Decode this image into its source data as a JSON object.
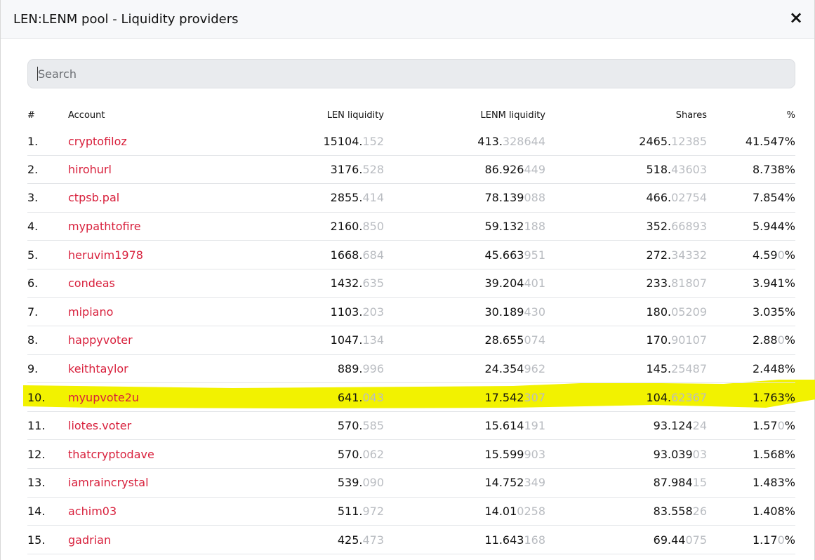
{
  "modal": {
    "title": "LEN:LENM pool - Liquidity providers",
    "close_icon": "×"
  },
  "search": {
    "placeholder": "Search",
    "value": ""
  },
  "columns": [
    "#",
    "Account",
    "LEN liquidity",
    "LENM liquidity",
    "Shares",
    "%"
  ],
  "highlight_color": "#f2f200",
  "accent_color": "#d8203c",
  "rows": [
    {
      "n": "1.",
      "account": "cryptofiloz",
      "len": [
        "15104.",
        "152"
      ],
      "lenm": [
        "413.",
        "328644"
      ],
      "shares": [
        "2465.",
        "12385"
      ],
      "pct": [
        "41.547%",
        ""
      ],
      "pct_tail": ""
    },
    {
      "n": "2.",
      "account": "hirohurl",
      "len": [
        "3176.",
        "528"
      ],
      "lenm": [
        "86.926",
        "449"
      ],
      "shares": [
        "518.",
        "43603"
      ],
      "pct": [
        "8.738%",
        ""
      ],
      "pct_tail": ""
    },
    {
      "n": "3.",
      "account": "ctpsb.pal",
      "len": [
        "2855.",
        "414"
      ],
      "lenm": [
        "78.139",
        "088"
      ],
      "shares": [
        "466.",
        "02754"
      ],
      "pct": [
        "7.854%",
        ""
      ],
      "pct_tail": ""
    },
    {
      "n": "4.",
      "account": "mypathtofire",
      "len": [
        "2160.",
        "850"
      ],
      "lenm": [
        "59.132",
        "188"
      ],
      "shares": [
        "352.",
        "66893"
      ],
      "pct": [
        "5.944%",
        ""
      ],
      "pct_tail": ""
    },
    {
      "n": "5.",
      "account": "heruvim1978",
      "len": [
        "1668.",
        "684"
      ],
      "lenm": [
        "45.663",
        "951"
      ],
      "shares": [
        "272.",
        "34332"
      ],
      "pct": [
        "4.59",
        "0"
      ],
      "pct_tail": "%"
    },
    {
      "n": "6.",
      "account": "condeas",
      "len": [
        "1432.",
        "635"
      ],
      "lenm": [
        "39.204",
        "401"
      ],
      "shares": [
        "233.",
        "81807"
      ],
      "pct": [
        "3.941%",
        ""
      ],
      "pct_tail": ""
    },
    {
      "n": "7.",
      "account": "mipiano",
      "len": [
        "1103.",
        "203"
      ],
      "lenm": [
        "30.189",
        "430"
      ],
      "shares": [
        "180.",
        "05209"
      ],
      "pct": [
        "3.035%",
        ""
      ],
      "pct_tail": ""
    },
    {
      "n": "8.",
      "account": "happyvoter",
      "len": [
        "1047.",
        "134"
      ],
      "lenm": [
        "28.655",
        "074"
      ],
      "shares": [
        "170.",
        "90107"
      ],
      "pct": [
        "2.88",
        "0"
      ],
      "pct_tail": "%"
    },
    {
      "n": "9.",
      "account": "keithtaylor",
      "len": [
        "889.",
        "996"
      ],
      "lenm": [
        "24.354",
        "962"
      ],
      "shares": [
        "145.",
        "25487"
      ],
      "pct": [
        "2.448%",
        ""
      ],
      "pct_tail": ""
    },
    {
      "n": "10.",
      "account": "myupvote2u",
      "len": [
        "641.",
        "043"
      ],
      "lenm": [
        "17.542",
        "307"
      ],
      "shares": [
        "104.",
        "62367"
      ],
      "pct": [
        "1.763%",
        ""
      ],
      "pct_tail": "",
      "highlighted": true
    },
    {
      "n": "11.",
      "account": "liotes.voter",
      "len": [
        "570.",
        "585"
      ],
      "lenm": [
        "15.614",
        "191"
      ],
      "shares": [
        "93.124",
        "24"
      ],
      "pct": [
        "1.57",
        "0"
      ],
      "pct_tail": "%"
    },
    {
      "n": "12.",
      "account": "thatcryptodave",
      "len": [
        "570.",
        "062"
      ],
      "lenm": [
        "15.599",
        "903"
      ],
      "shares": [
        "93.039",
        "03"
      ],
      "pct": [
        "1.568%",
        ""
      ],
      "pct_tail": ""
    },
    {
      "n": "13.",
      "account": "iamraincrystal",
      "len": [
        "539.",
        "090"
      ],
      "lenm": [
        "14.752",
        "349"
      ],
      "shares": [
        "87.984",
        "15"
      ],
      "pct": [
        "1.483%",
        ""
      ],
      "pct_tail": ""
    },
    {
      "n": "14.",
      "account": "achim03",
      "len": [
        "511.",
        "972"
      ],
      "lenm": [
        "14.01",
        "0258"
      ],
      "shares": [
        "83.558",
        "26"
      ],
      "pct": [
        "1.408%",
        ""
      ],
      "pct_tail": ""
    },
    {
      "n": "15.",
      "account": "gadrian",
      "len": [
        "425.",
        "473"
      ],
      "lenm": [
        "11.643",
        "168"
      ],
      "shares": [
        "69.44",
        "075"
      ],
      "pct": [
        "1.17",
        "0"
      ],
      "pct_tail": "%"
    }
  ]
}
